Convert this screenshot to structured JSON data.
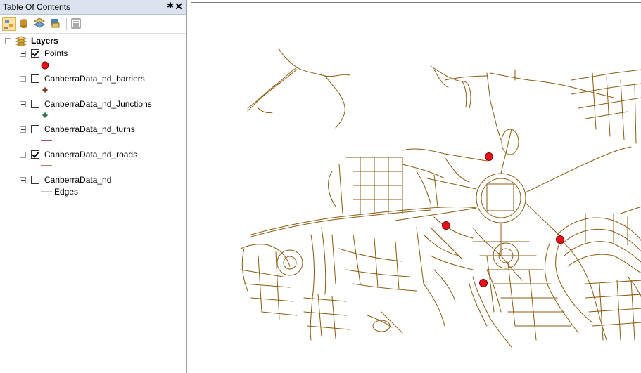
{
  "toc": {
    "title": "Table Of Contents",
    "pin_glyph": "✱",
    "close_glyph": "✕",
    "toolbar": [
      {
        "name": "list-by-drawing-order-icon",
        "active": true
      },
      {
        "name": "list-by-source-icon",
        "active": false
      },
      {
        "name": "list-by-visibility-icon",
        "active": false
      },
      {
        "name": "list-by-selection-icon",
        "active": false
      },
      {
        "name": "options-icon",
        "active": false
      }
    ],
    "root_label": "Layers",
    "layers": [
      {
        "label": "Points",
        "checked": true,
        "legend_type": "point",
        "legend_color": "#e8101a"
      },
      {
        "label": "CanberraData_nd_barriers",
        "checked": false,
        "legend_type": "diamond",
        "legend_color": "#8b3a1a"
      },
      {
        "label": "CanberraData_nd_Junctions",
        "checked": false,
        "legend_type": "diamond",
        "legend_color": "#2f7a4a"
      },
      {
        "label": "CanberraData_nd_turns",
        "checked": false,
        "legend_type": "line",
        "legend_color": "#8b1a3a"
      },
      {
        "label": "CanberraData_nd_roads",
        "checked": true,
        "legend_type": "line",
        "legend_color": "#a0522d"
      },
      {
        "label": "CanberraData_nd",
        "checked": false,
        "legend_type": "line",
        "legend_color": "#8c8c8c",
        "legend_label": "Edges"
      }
    ]
  },
  "map": {
    "road_color": "#8b5a10",
    "point_color": "#e8101a"
  }
}
